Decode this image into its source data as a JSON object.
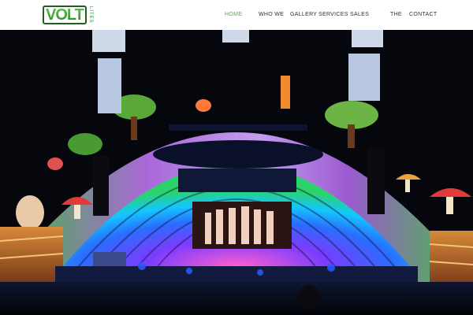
{
  "brand": {
    "logo_text": "VOLT",
    "logo_sub": "LITES"
  },
  "nav": {
    "items": [
      {
        "label": "HOME",
        "active": true
      },
      {
        "label": "WHO WE",
        "active": false
      },
      {
        "label": "GALLERY",
        "active": false
      },
      {
        "label": "SERVICES",
        "active": false
      },
      {
        "label": "SALES",
        "active": false
      },
      {
        "label": "THE",
        "active": false
      },
      {
        "label": "CONTACT",
        "active": false
      }
    ]
  },
  "colors": {
    "accent": "#4caf50",
    "header_bg": "#ffffff",
    "nav_text": "#333333"
  },
  "hero": {
    "icon": "concert-stage-image"
  }
}
